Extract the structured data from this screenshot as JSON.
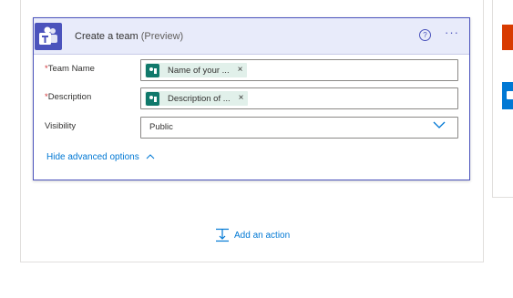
{
  "action_card": {
    "title": "Create a team",
    "title_suffix": "(Preview)",
    "help_icon": "?",
    "more_icon": "···",
    "fields": {
      "team_name": {
        "required_mark": "*",
        "label": "Team Name",
        "token_label": "Name of your ...",
        "token_remove": "×"
      },
      "description": {
        "required_mark": "*",
        "label": "Description",
        "token_label": "Description of ...",
        "token_remove": "×"
      },
      "visibility": {
        "label": "Visibility",
        "value": "Public"
      }
    },
    "advanced_toggle": {
      "label": "Hide advanced options",
      "icon": "^"
    }
  },
  "add_action": {
    "label": "Add an action"
  },
  "icons": {
    "card": "teams-icon",
    "token": "forms-icon",
    "help": "help-icon",
    "more": "more-options-icon",
    "chevron": "chevron-down-icon",
    "add_action": "add-action-icon"
  },
  "colors": {
    "accent": "#4b53bc",
    "header_bg": "#e8ebfa",
    "link": "#0078d4",
    "token_bg": "#e1f0ea",
    "token_icon": "#10796b",
    "required": "#d13438",
    "side_orange": "#d83b01",
    "side_blue": "#0078d4"
  }
}
